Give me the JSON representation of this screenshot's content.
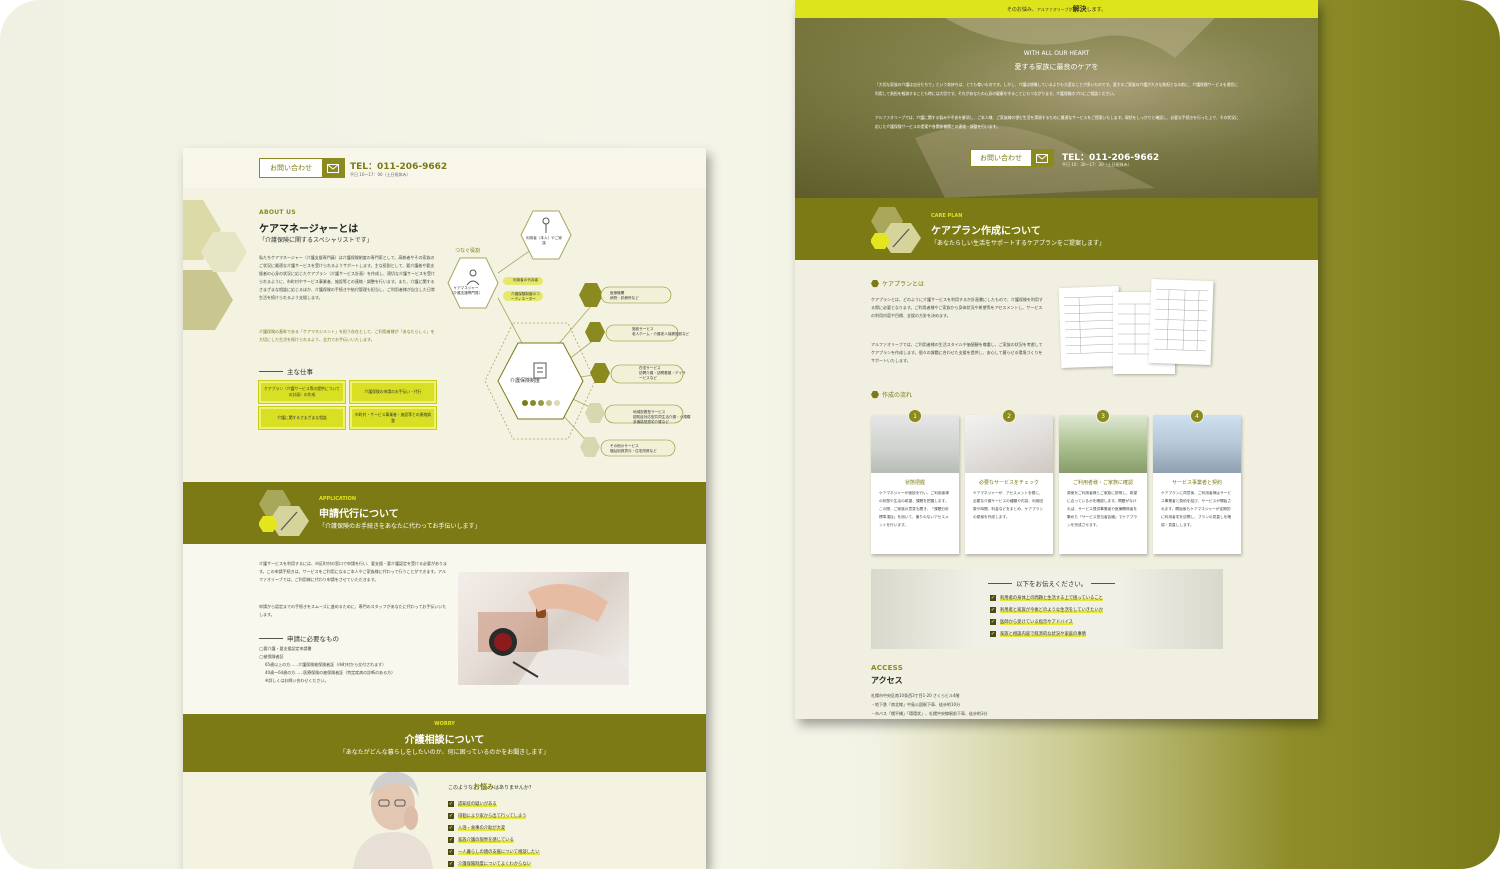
{
  "colors": {
    "olive": "#7b7a14",
    "lime": "#dde41c",
    "cream": "#f4f3e2"
  },
  "left": {
    "header": {
      "contact_label": "お問い合わせ",
      "tel": "TEL：011-206-9662",
      "hours": "平日 10〜17：00（土日祝休み）"
    },
    "about": {
      "tag": "ABOUT US",
      "title": "ケアマネージャーとは",
      "quote": "「介護保険に関するスペシャリストです」",
      "p1": "私たちケアマネージャー（介護支援専門員）は介護保険制度の専門家として、高齢者やその家族のご状況に最適な介護サービスを受けられるようサポートします。主な役割として、要介護者や要支援者の心身の状況に応じたケアプラン（介護サービス計画）を作成し、適切な介護サービスを受けられるように、市町村やサービス事業者、施設等との連絡・調整を行います。また、介護に関するさまざまな相談に応じるほか、介護保険の手続きや給付管理も担当し、ご利用者様が自立した日常生活を続けられるよう支援します。",
      "p2": "介護保険の基幹である「ケアマネジメント」を担う存在として、ご利用者様が「あなたらしく」を大切にした生活を続けられるよう、全力でお手伝いいたします。",
      "jobs_title": "主な仕事",
      "jobs": [
        "ケアプラン（介護サービス等の提供についての計画）の作成",
        "介護保険の申請のお手伝い・代行",
        "介護に関するさまざまな相談",
        "市町村・サービス事業者・施設等との連絡調整"
      ]
    },
    "diagram": {
      "connect_label": "つなぐ役割",
      "user": "利用者（本人）やご家族",
      "care_manager": "ケアマネジャー",
      "care_manager_sub": "（介護支援専門員）",
      "small1": "利用者の代弁者",
      "small2": "介護保険制度のコーディネーター",
      "center": "介護保険制度",
      "services": [
        {
          "title": "医療機関",
          "sub": "病院・診療所など"
        },
        {
          "title": "施設サービス",
          "sub": "老人ホーム・介護老人保健施設など"
        },
        {
          "title": "在宅サービス",
          "sub": "訪問介護・訪問看護・デイサービスなど"
        },
        {
          "title": "地域密着型サービス",
          "sub": "認知症対応型共同生活介護・小規模多機能型居宅介護など"
        },
        {
          "title": "その他のサービス",
          "sub": "福祉用具貸与・住宅改修など"
        }
      ]
    },
    "application": {
      "tag": "APPLICATION",
      "title": "申請代行について",
      "quote": "「介護保険のお手続きをあなたに代わってお手伝いします」",
      "p1": "介護サービスを利用するには、市区町村の窓口で申請を行い、要支援・要介護認定を受ける必要があります。この申請手続きは、サービスをご利用になるご本人やご家族様に代わって行うことができます。アルファオリーブでは、ご利用様に代わり申請をさせていただきます。",
      "p2": "申請から認定までの手続きをスムーズに進めるために、専門のスタッフがあなたに代わってお手伝いいたします。",
      "needs_title": "申請に必要なもの",
      "needs": [
        "◯要介護・要支援認定申請書",
        "◯被保険者証",
        "65歳以上の方……介護保険被保険者証（市町村から交付されます）",
        "40歳〜64歳の方……医療保険の被保険者証（特定疾病の診断のある方）",
        "※詳しくはお問い合わせください。"
      ]
    },
    "worry": {
      "tag": "WORRY",
      "title": "介護相談について",
      "quote": "「あなたがどんな暮らしをしたいのか、何に困っているのかをお聞きします」",
      "q_prefix": "このような",
      "q_em": "お悩み",
      "q_suffix": "はありませんか？",
      "checks": [
        "認知症の疑いがある",
        "徘徊により家から出て行ってしまう",
        "入浴・食事の介助が大変",
        "家族介護の限界を感じている",
        "一人暮らしの親の支援について相談したい",
        "介護保険制度についてよくわからない"
      ]
    }
  },
  "right": {
    "topbar_pre": "そのお悩み、",
    "topbar_mid": "アルファオリーブが",
    "topbar_em": "解決",
    "topbar_post": "します。",
    "hero": {
      "en": "WITH ALL OUR HEART",
      "title": "愛する家族に最良のケアを",
      "p1": "「大切な家族の介護は自分たちで」という気持ちは、とても尊いものです。しかし、介護は想像しているよりも大変なことが多いものです。愛するご家族の介護が大きな負担となる前に、介護保険サービスを適切に利用して負担を軽減することも時には大切です。それがあなたの心身の健康を守ることにもつながります。介護保険のプロにご相談ください。",
      "p2": "アルファオリーブでは、介護に関する悩みや不安を解消し、ご本人様、ご家族様の望む生活を実現するために最適なサービスをご提案いたします。現状をしっかりと確認し、必要な手続きを行った上で、その状況に応じた介護保険サービスの提案や各関係機関との連絡・調整を行います。",
      "contact_label": "お問い合わせ",
      "tel": "TEL：011-206-9662",
      "hours": "平日 10：30〜17：30（土日祝休み）"
    },
    "careplan": {
      "tag": "CARE PLAN",
      "title": "ケアプラン作成について",
      "quote": "「あなたらしい生活をサポートするケアプランをご提案します」",
      "about_title": "ケアプランとは",
      "p1": "ケアプランとは、どのように介護サービスを利用するか計画書にしたもので、介護保険を利用する際に必要となります。ご利用者様やご家族から身体状況や希望等をアセスメントし、サービスの利用内容や目標、支援の方針を決めます。",
      "p2": "アルファオリーブでは、ご利用者様の生活スタイルや価値観を尊重し、ご家族の状況を考慮してケアプランを作成します。個々の課題に合わせた支援を提供し、安心して暮らせる環境づくりをサポートいたします。",
      "flow_title": "作成の流れ",
      "flow": [
        {
          "num": "1",
          "title": "状態把握",
          "text": "ケアマネジャーが面談を行い、ご利用者様の状態や生活の希望、課題を把握します。この際、ご家族の意見も聞き、「課題分析標準項目」を用いて、偏りのないアセスメントを行います。"
        },
        {
          "num": "2",
          "title": "必要なサービスをチェック",
          "text": "ケアマネジャーが、アセスメントを基に、必要な介護サービスの種類や内容、利用回数や時間、料金などをまとめ、ケアプランの原案を作成します。"
        },
        {
          "num": "3",
          "title": "ご利用者様・ご家族に確認",
          "text": "原案をご利用者様とご家族に説明し、希望に合っているかを確認します。問題がなければ、サービス提供事業者や医療関係者を集めた「サービス担当者会議」でケアプランを完成させます。"
        },
        {
          "num": "4",
          "title": "サービス事業者と契約",
          "text": "ケアプランに同意後、ご利用者様はサービス事業者と契約を結び、サービスが開始されます。開始後もケアマネジャーが定期的に利用者宅を訪問し、プランの見直しを確認・見直しします。"
        }
      ],
      "notice_title": "以下をお伝えください。",
      "notices": [
        "利用者の身体上の問題と生活する上で困っていること",
        "利用者と家族が今後どのような生活をしていきたいか",
        "医師から受けている指示やアドバイス",
        "家族と相談内容で経済的な状況や家庭の事情"
      ]
    },
    "access": {
      "tag": "ACCESS",
      "title": "アクセス",
      "address": "札幌市中央区南10条西3丁目1-20 さくらビル4階",
      "line1": "・地下鉄「南北線」中島公園駅下車、徒歩約10分",
      "line2": "・市バス「幌平橋」「環環状」、札幌中央線駅前下車、徒歩約3分"
    }
  }
}
